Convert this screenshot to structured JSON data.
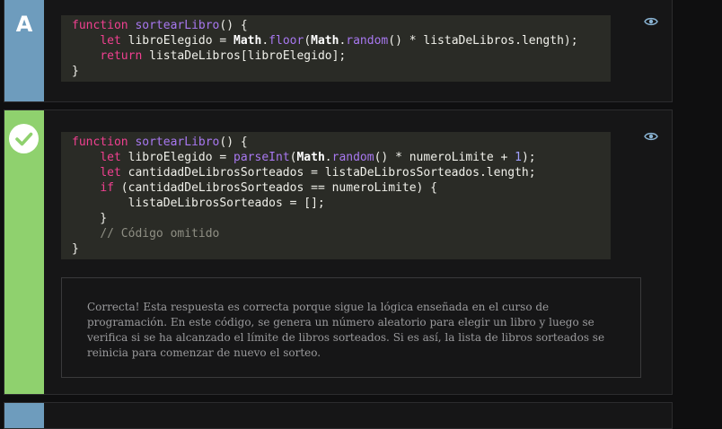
{
  "options": [
    {
      "letter": "A",
      "code_lines": [
        [
          {
            "t": "function ",
            "c": "kw"
          },
          {
            "t": "sortearLibro",
            "c": "fn"
          },
          {
            "t": "() {",
            "c": ""
          }
        ],
        [
          {
            "t": "    ",
            "c": ""
          },
          {
            "t": "let ",
            "c": "kw"
          },
          {
            "t": "libroElegido = ",
            "c": ""
          },
          {
            "t": "Math",
            "c": "obj"
          },
          {
            "t": ".",
            "c": ""
          },
          {
            "t": "floor",
            "c": "fn"
          },
          {
            "t": "(",
            "c": ""
          },
          {
            "t": "Math",
            "c": "obj"
          },
          {
            "t": ".",
            "c": ""
          },
          {
            "t": "random",
            "c": "fn"
          },
          {
            "t": "() * listaDeLibros.length);",
            "c": ""
          }
        ],
        [
          {
            "t": "    ",
            "c": ""
          },
          {
            "t": "return ",
            "c": "kw"
          },
          {
            "t": "listaDeLibros[libroElegido];",
            "c": ""
          }
        ],
        [
          {
            "t": "}",
            "c": ""
          }
        ]
      ]
    },
    {
      "status": "correct",
      "code_lines": [
        [
          {
            "t": "function ",
            "c": "kw"
          },
          {
            "t": "sortearLibro",
            "c": "fn"
          },
          {
            "t": "() {",
            "c": ""
          }
        ],
        [
          {
            "t": "    ",
            "c": ""
          },
          {
            "t": "let ",
            "c": "kw"
          },
          {
            "t": "libroElegido = ",
            "c": ""
          },
          {
            "t": "parseInt",
            "c": "fn"
          },
          {
            "t": "(",
            "c": ""
          },
          {
            "t": "Math",
            "c": "obj"
          },
          {
            "t": ".",
            "c": ""
          },
          {
            "t": "random",
            "c": "fn"
          },
          {
            "t": "() * numeroLimite + ",
            "c": ""
          },
          {
            "t": "1",
            "c": "num"
          },
          {
            "t": ");",
            "c": ""
          }
        ],
        [
          {
            "t": "    ",
            "c": ""
          },
          {
            "t": "let ",
            "c": "kw"
          },
          {
            "t": "cantidadDeLibrosSorteados = listaDeLibrosSorteados.length;",
            "c": ""
          }
        ],
        [
          {
            "t": "    ",
            "c": ""
          },
          {
            "t": "if ",
            "c": "kw"
          },
          {
            "t": "(cantidadDeLibrosSorteados == numeroLimite) {",
            "c": ""
          }
        ],
        [
          {
            "t": "        listaDeLibrosSorteados = [];",
            "c": ""
          }
        ],
        [
          {
            "t": "    }",
            "c": ""
          }
        ],
        [
          {
            "t": "    ",
            "c": ""
          },
          {
            "t": "// Código omitido",
            "c": "cmt"
          }
        ],
        [
          {
            "t": "}",
            "c": ""
          }
        ]
      ],
      "feedback": "Correcta! Esta respuesta es correcta porque sigue la lógica enseñada en el curso de programación. En este código, se genera un número aleatorio para elegir un libro y luego se verifica si se ha alcanzado el límite de libros sorteados. Si es así, la lista de libros sorteados se reinicia para comenzar de nuevo el sorteo."
    }
  ],
  "colors": {
    "option_side_default": "#6e9cbd",
    "option_side_correct": "#8fd16e",
    "eye_icon": "#8ab4d4",
    "code_bg": "#2a2b26"
  },
  "icons": {
    "visibility": "eye-icon",
    "correct": "check-icon"
  }
}
